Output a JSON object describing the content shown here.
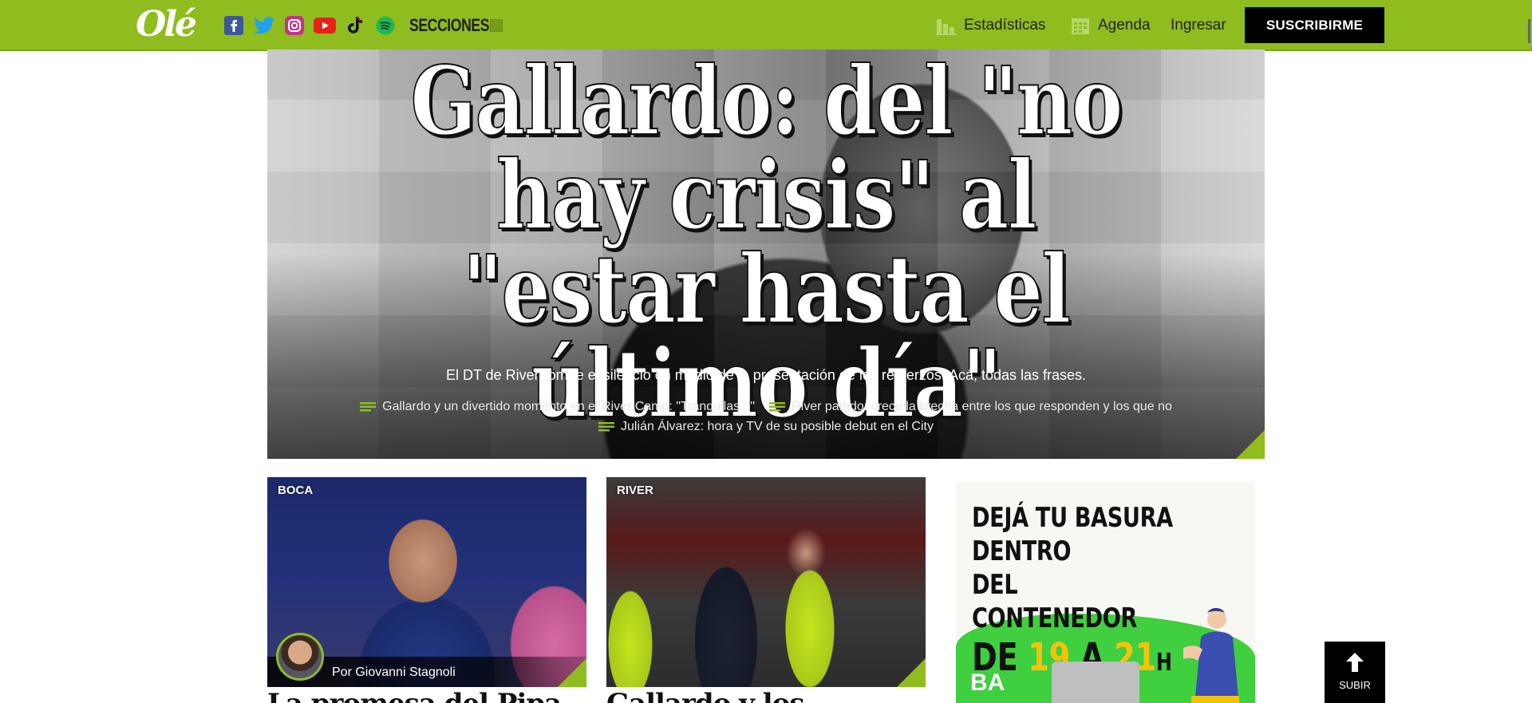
{
  "header": {
    "logo": "Olé",
    "socials": [
      {
        "name": "facebook-icon",
        "color": "#3b5998"
      },
      {
        "name": "twitter-icon",
        "color": "#1da1f2"
      },
      {
        "name": "instagram-icon",
        "color": "#c13584"
      },
      {
        "name": "youtube-icon",
        "color": "#e62117"
      },
      {
        "name": "tiktok-icon",
        "color": "#111111"
      },
      {
        "name": "spotify-icon",
        "color": "#1db954"
      }
    ],
    "secciones_label": "SECCIONES",
    "nav": {
      "stats_label": "Estadísticas",
      "agenda_label": "Agenda",
      "login_label": "Ingresar"
    },
    "subscribe_label": "SUSCRIBIRME",
    "brand_color": "#8fbc1f"
  },
  "hero": {
    "title": "Gallardo: del \"no hay crisis\" al \"estar hasta el último día\"",
    "subtitle": "El DT de River rompe el silencio en medio de la presentación de los refuerzos. Acá, todas las frases.",
    "related": [
      "Gallardo y un divertido momento en el River Camp: \"Tranquilas...\"",
      "River partido: crece la brecha entre los que responden y los que no",
      "Julián Álvarez: hora y TV de su posible debut en el City"
    ]
  },
  "cards": [
    {
      "tag": "BOCA",
      "author": "Por Giovanni Stagnoli",
      "headline": "La promesa del Pipa tras"
    },
    {
      "tag": "RIVER",
      "headline": "Gallardo y los árbitros:"
    }
  ],
  "ad": {
    "line1": "DEJÁ TU BASURA DENTRO",
    "line2": "DEL CONTENEDOR",
    "line3_a": "DE ",
    "line3_b": "19",
    "line3_c": " A ",
    "line3_d": "21",
    "line3_e": "H",
    "brand": "BA"
  },
  "subir_label": "SUBIR"
}
